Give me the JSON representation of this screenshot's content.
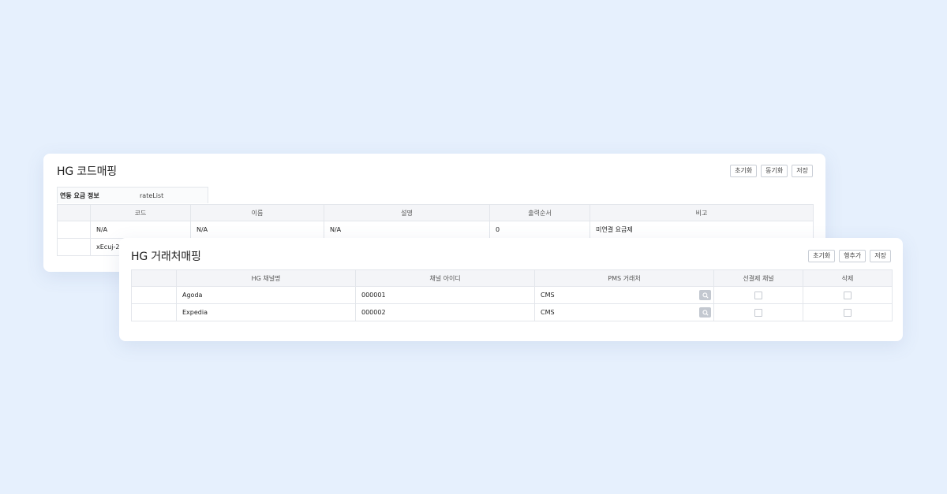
{
  "code_card": {
    "title": "HG 코드매핑",
    "buttons": [
      "초기화",
      "동기화",
      "저장"
    ],
    "info_label": "연동 요금 정보",
    "info_value": "rateList",
    "columns": [
      "",
      "코드",
      "이름",
      "설명",
      "출력순서",
      "비고"
    ],
    "rows": [
      [
        "",
        "N/A",
        "N/A",
        "N/A",
        "0",
        "미연결 요금제"
      ],
      [
        "",
        "xEcuj-20",
        "",
        "",
        "",
        ""
      ]
    ]
  },
  "vendor_card": {
    "title": "HG 거래처매핑",
    "buttons": [
      "초기화",
      "행추가",
      "저장"
    ],
    "columns": [
      "",
      "HG 채널명",
      "채널 아이디",
      "PMS 거래처",
      "선결제 채널",
      "삭제"
    ],
    "rows": [
      {
        "channel": "Agoda",
        "channel_id": "000001",
        "pms": "CMS"
      },
      {
        "channel": "Expedia",
        "channel_id": "000002",
        "pms": "CMS"
      }
    ]
  },
  "colors": {
    "background": "#e6f0fd",
    "header_bg": "#f4f5f8",
    "search_btn": "#c3c8d0"
  }
}
